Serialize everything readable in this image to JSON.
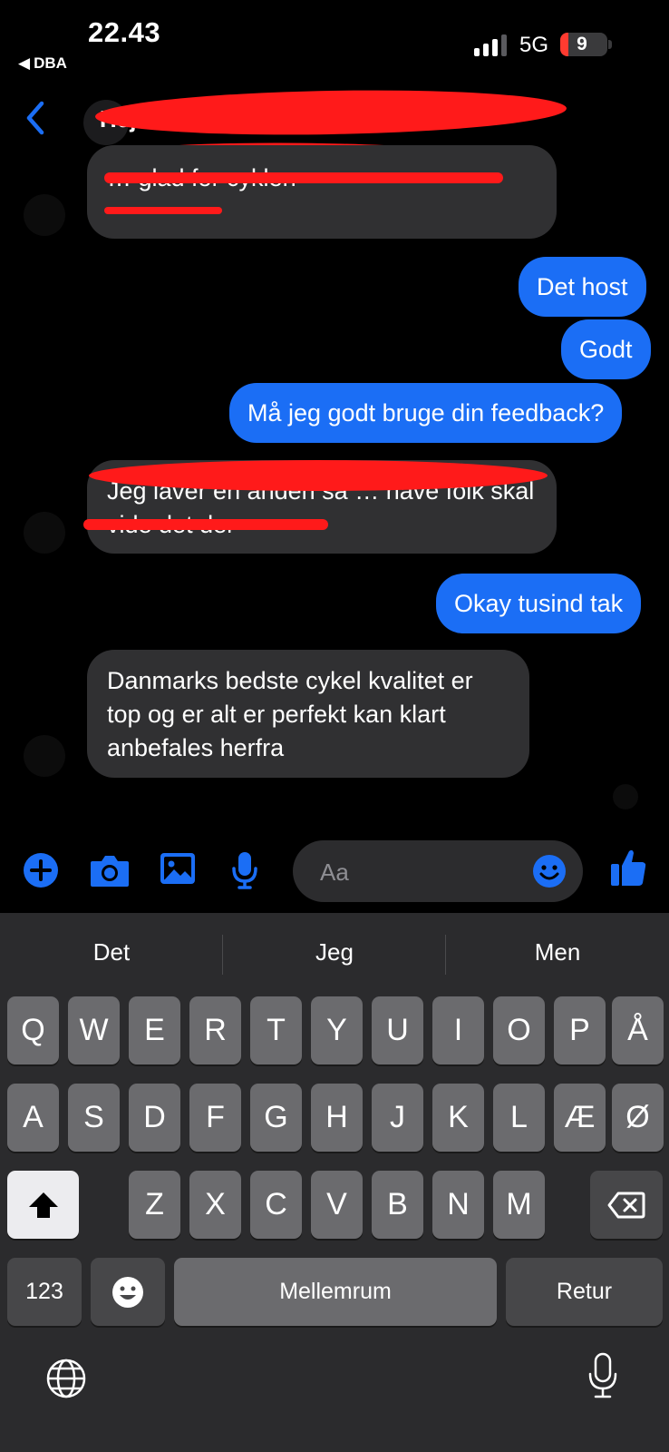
{
  "status_bar": {
    "time": "22.43",
    "back_app": "DBA",
    "network": "5G",
    "battery": "9",
    "battery_level_percent": 9
  },
  "header": {
    "contact_name": "Hej · Herny eroy"
  },
  "messages": [
    {
      "side": "in",
      "text": "… glad for cyklen",
      "redacted": true
    },
    {
      "side": "out",
      "text": "Det host"
    },
    {
      "side": "out",
      "text": "Godt"
    },
    {
      "side": "out",
      "text": "Må jeg godt bruge din feedback?"
    },
    {
      "side": "in",
      "text": "Jeg laver en anden sa … have folk skal vide det der",
      "redacted": true
    },
    {
      "side": "out",
      "text": "Okay tusind tak"
    },
    {
      "side": "in",
      "text": "Danmarks bedste cykel kvalitet er top og er alt er perfekt kan klart anbefales herfra"
    }
  ],
  "composer": {
    "placeholder": "Aa",
    "icons": [
      "plus-icon",
      "camera-icon",
      "image-icon",
      "microphone-icon",
      "emoji-icon",
      "thumbs-up-icon"
    ]
  },
  "keyboard": {
    "suggestions": [
      "Det",
      "Jeg",
      "Men"
    ],
    "row1": [
      "Q",
      "W",
      "E",
      "R",
      "T",
      "Y",
      "U",
      "I",
      "O",
      "P",
      "Å"
    ],
    "row2": [
      "A",
      "S",
      "D",
      "F",
      "G",
      "H",
      "J",
      "K",
      "L",
      "Æ",
      "Ø"
    ],
    "row3": [
      "Z",
      "X",
      "C",
      "V",
      "B",
      "N",
      "M"
    ],
    "numbers_label": "123",
    "space_label": "Mellemrum",
    "return_label": "Retur"
  },
  "colors": {
    "outgoing_bubble": "#1b6ef5",
    "incoming_bubble": "#303032",
    "accent": "#1b6ef5",
    "keyboard_bg": "#2b2b2d"
  }
}
